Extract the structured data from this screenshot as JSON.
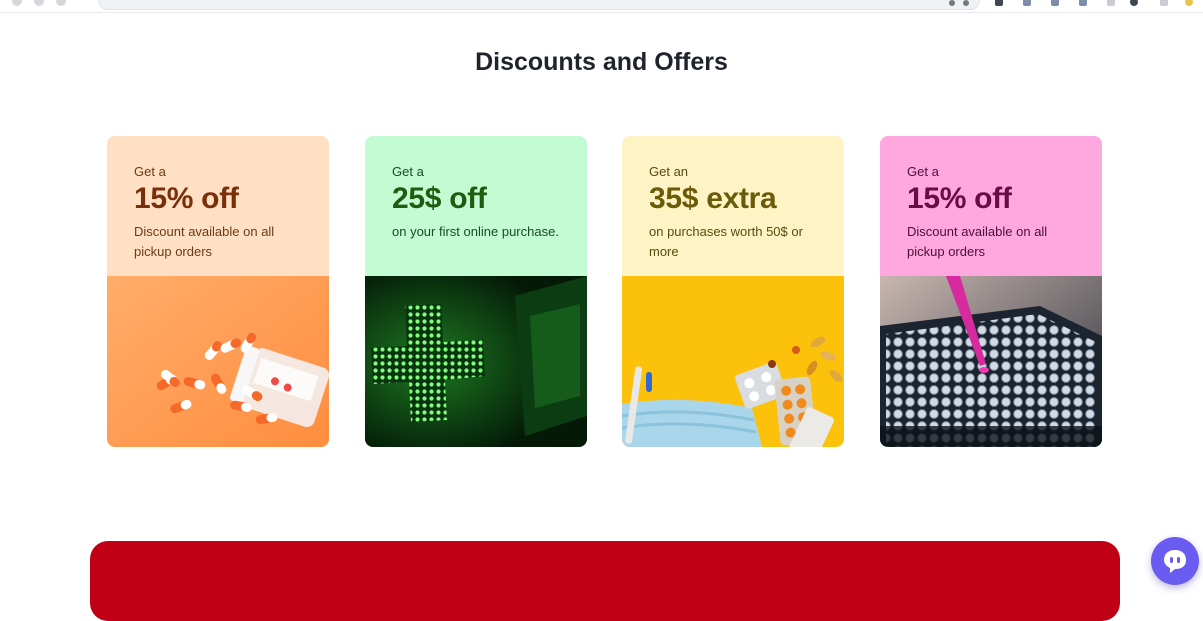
{
  "section": {
    "title": "Discounts and Offers"
  },
  "offers": [
    {
      "prefix": "Get a",
      "headline": "15% off",
      "description": "Discount available on all pickup orders",
      "image": "pills-spilling-from-bottle",
      "colors": {
        "bg": "#ffe0c4",
        "prefix": "#6b3a16",
        "headline": "#7a2f0b",
        "description": "#6b3a16"
      }
    },
    {
      "prefix": "Get a",
      "headline": "25$ off",
      "description": "on your first online purchase.",
      "image": "green-pharmacy-cross-sign",
      "colors": {
        "bg": "#c3fbd2",
        "prefix": "#1c4a24",
        "headline": "#1e5c10",
        "description": "#1c4a24"
      }
    },
    {
      "prefix": "Get an",
      "headline": "35$ extra",
      "description": "on purchases worth 50$ or more",
      "image": "mask-thermometer-pill-blisters",
      "colors": {
        "bg": "#fef3c4",
        "prefix": "#5a4a10",
        "headline": "#6b5a08",
        "description": "#5a4a10"
      }
    },
    {
      "prefix": "Get a",
      "headline": "15% off",
      "description": "Discount available on all pickup orders",
      "image": "lab-test-tubes-with-pipette",
      "colors": {
        "bg": "#ffa7de",
        "prefix": "#4a1038",
        "headline": "#6a0a46",
        "description": "#4a1038"
      }
    }
  ],
  "banner": {
    "color": "#c00014"
  },
  "chat": {
    "icon": "chat-bubble-icon",
    "color": "#6a5cf0"
  }
}
